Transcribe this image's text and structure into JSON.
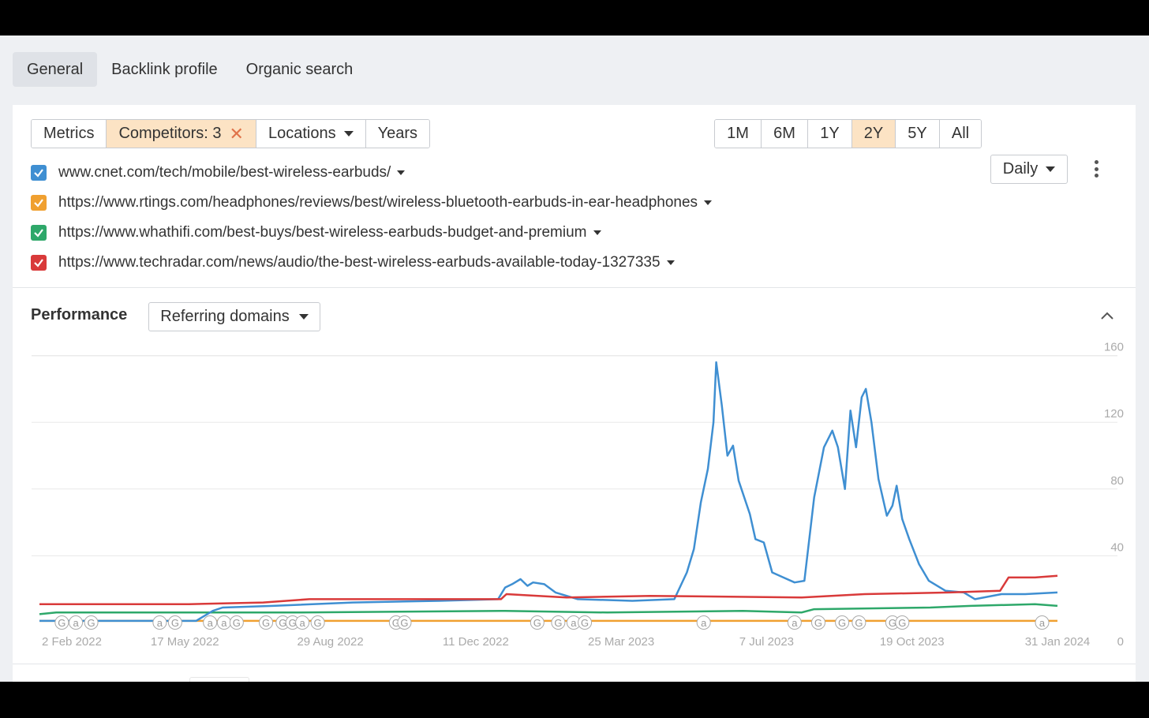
{
  "tabs": [
    "General",
    "Backlink profile",
    "Organic search"
  ],
  "filters": {
    "metrics": "Metrics",
    "competitors": "Competitors: 3",
    "locations": "Locations",
    "years": "Years"
  },
  "ranges": [
    "1M",
    "6M",
    "1Y",
    "2Y",
    "5Y",
    "All"
  ],
  "active_range": "2Y",
  "interval": "Daily",
  "urls": [
    {
      "url": "www.cnet.com/tech/mobile/best-wireless-earbuds/",
      "color": "#3f8fd2"
    },
    {
      "url": "https://www.rtings.com/headphones/reviews/best/wireless-bluetooth-earbuds-in-ear-headphones",
      "color": "#f0a030"
    },
    {
      "url": "https://www.whathifi.com/best-buys/best-wireless-earbuds-budget-and-premium",
      "color": "#2ea86a"
    },
    {
      "url": "https://www.techradar.com/news/audio/the-best-wireless-earbuds-available-today-1327335",
      "color": "#d93a3a"
    }
  ],
  "performance": {
    "title": "Performance",
    "metric": "Referring domains"
  },
  "chart_data": {
    "type": "line",
    "x_ticks": [
      "2 Feb 2022",
      "17 May 2022",
      "29 Aug 2022",
      "11 Dec 2022",
      "25 Mar 2023",
      "7 Jul 2023",
      "19 Oct 2023",
      "31 Jan 2024"
    ],
    "y_ticks": [
      0,
      40,
      80,
      120,
      160
    ],
    "ylim": [
      0,
      160
    ],
    "series": [
      {
        "name": "www.cnet.com/tech/mobile/best-wireless-earbuds/",
        "color": "#3f8fd2",
        "points": [
          [
            "2022-02-02",
            1
          ],
          [
            "2022-05-25",
            1
          ],
          [
            "2022-06-06",
            7
          ],
          [
            "2022-06-13",
            9
          ],
          [
            "2022-07-19",
            10
          ],
          [
            "2022-09-14",
            12
          ],
          [
            "2022-11-15",
            13
          ],
          [
            "2022-12-27",
            14
          ],
          [
            "2023-01-01",
            21
          ],
          [
            "2023-01-06",
            23
          ],
          [
            "2023-01-12",
            26
          ],
          [
            "2023-01-17",
            22
          ],
          [
            "2023-01-21",
            24
          ],
          [
            "2023-01-29",
            23
          ],
          [
            "2023-02-06",
            18
          ],
          [
            "2023-02-22",
            14
          ],
          [
            "2023-04-02",
            13
          ],
          [
            "2023-05-02",
            14
          ],
          [
            "2023-05-11",
            30
          ],
          [
            "2023-05-16",
            44
          ],
          [
            "2023-05-21",
            72
          ],
          [
            "2023-05-26",
            92
          ],
          [
            "2023-05-30",
            120
          ],
          [
            "2023-06-01",
            156
          ],
          [
            "2023-06-05",
            130
          ],
          [
            "2023-06-09",
            100
          ],
          [
            "2023-06-13",
            106
          ],
          [
            "2023-06-17",
            85
          ],
          [
            "2023-06-21",
            75
          ],
          [
            "2023-06-25",
            65
          ],
          [
            "2023-06-29",
            50
          ],
          [
            "2023-07-05",
            48
          ],
          [
            "2023-07-11",
            30
          ],
          [
            "2023-07-19",
            27
          ],
          [
            "2023-07-27",
            24
          ],
          [
            "2023-08-03",
            25
          ],
          [
            "2023-08-10",
            75
          ],
          [
            "2023-08-17",
            105
          ],
          [
            "2023-08-23",
            115
          ],
          [
            "2023-08-27",
            105
          ],
          [
            "2023-09-01",
            80
          ],
          [
            "2023-09-05",
            127
          ],
          [
            "2023-09-09",
            105
          ],
          [
            "2023-09-13",
            135
          ],
          [
            "2023-09-16",
            140
          ],
          [
            "2023-09-20",
            120
          ],
          [
            "2023-09-25",
            86
          ],
          [
            "2023-10-01",
            64
          ],
          [
            "2023-10-05",
            70
          ],
          [
            "2023-10-08",
            82
          ],
          [
            "2023-10-12",
            62
          ],
          [
            "2023-10-17",
            50
          ],
          [
            "2023-10-24",
            35
          ],
          [
            "2023-10-31",
            25
          ],
          [
            "2023-11-12",
            19
          ],
          [
            "2023-11-25",
            18
          ],
          [
            "2023-12-03",
            14
          ],
          [
            "2023-12-22",
            17
          ],
          [
            "2024-01-08",
            17
          ],
          [
            "2024-01-31",
            18
          ]
        ]
      },
      {
        "name": "https://www.rtings.com/headphones/reviews/best/wireless-bluetooth-earbuds-in-ear-headphones",
        "color": "#f0a030",
        "points": [
          [
            "2022-02-02",
            1
          ],
          [
            "2024-01-31",
            1
          ]
        ]
      },
      {
        "name": "https://www.whathifi.com/best-buys/best-wireless-earbuds-budget-and-premium",
        "color": "#2ea86a",
        "points": [
          [
            "2022-02-02",
            5
          ],
          [
            "2022-02-14",
            6
          ],
          [
            "2022-06-15",
            6
          ],
          [
            "2022-08-01",
            6
          ],
          [
            "2023-01-01",
            7
          ],
          [
            "2023-03-15",
            6
          ],
          [
            "2023-06-20",
            7
          ],
          [
            "2023-08-01",
            6
          ],
          [
            "2023-08-10",
            8
          ],
          [
            "2023-11-01",
            9
          ],
          [
            "2023-11-30",
            10
          ],
          [
            "2024-01-15",
            11
          ],
          [
            "2024-01-31",
            10
          ]
        ]
      },
      {
        "name": "https://www.techradar.com/news/audio/the-best-wireless-earbuds-available-today-1327335",
        "color": "#d93a3a",
        "points": [
          [
            "2022-02-02",
            11
          ],
          [
            "2022-05-20",
            11
          ],
          [
            "2022-07-12",
            12
          ],
          [
            "2022-08-14",
            14
          ],
          [
            "2022-12-29",
            14
          ],
          [
            "2023-01-02",
            17
          ],
          [
            "2023-02-14",
            15
          ],
          [
            "2023-04-15",
            16
          ],
          [
            "2023-08-01",
            15
          ],
          [
            "2023-09-15",
            17
          ],
          [
            "2023-11-15",
            18
          ],
          [
            "2023-12-21",
            19
          ],
          [
            "2023-12-27",
            27
          ],
          [
            "2024-01-15",
            27
          ],
          [
            "2024-01-31",
            28
          ]
        ]
      }
    ],
    "annotations": [
      {
        "date": "2022-02-18",
        "label": "G"
      },
      {
        "date": "2022-02-28",
        "label": "a"
      },
      {
        "date": "2022-03-11",
        "label": "G"
      },
      {
        "date": "2022-04-29",
        "label": "a"
      },
      {
        "date": "2022-05-10",
        "label": "G"
      },
      {
        "date": "2022-06-04",
        "label": "a"
      },
      {
        "date": "2022-06-14",
        "label": "a"
      },
      {
        "date": "2022-06-23",
        "label": "G"
      },
      {
        "date": "2022-07-14",
        "label": "G"
      },
      {
        "date": "2022-07-26",
        "label": "G"
      },
      {
        "date": "2022-08-02",
        "label": "G"
      },
      {
        "date": "2022-08-09",
        "label": "a"
      },
      {
        "date": "2022-08-20",
        "label": "G"
      },
      {
        "date": "2022-10-15",
        "label": "G"
      },
      {
        "date": "2022-10-21",
        "label": "G"
      },
      {
        "date": "2023-01-24",
        "label": "G"
      },
      {
        "date": "2023-02-08",
        "label": "G"
      },
      {
        "date": "2023-02-19",
        "label": "a"
      },
      {
        "date": "2023-02-27",
        "label": "G"
      },
      {
        "date": "2023-05-23",
        "label": "a"
      },
      {
        "date": "2023-07-27",
        "label": "a"
      },
      {
        "date": "2023-08-13",
        "label": "G"
      },
      {
        "date": "2023-08-30",
        "label": "G"
      },
      {
        "date": "2023-09-11",
        "label": "G"
      },
      {
        "date": "2023-10-05",
        "label": "G"
      },
      {
        "date": "2023-10-12",
        "label": "G"
      },
      {
        "date": "2024-01-20",
        "label": "a"
      }
    ]
  }
}
